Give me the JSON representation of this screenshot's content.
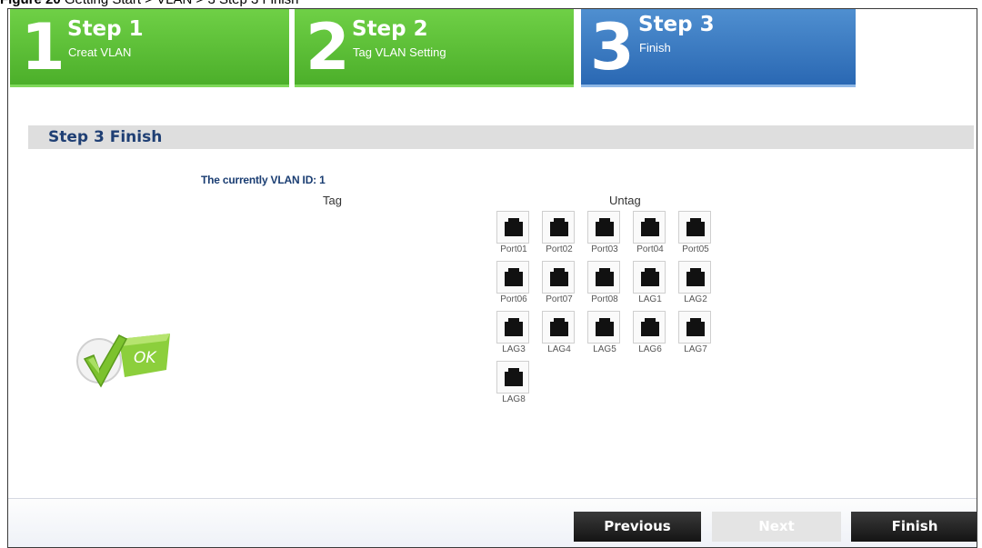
{
  "caption": {
    "prefix": "Figure 20",
    "text": "Getting Start > VLAN > 3 Step 3 Finish"
  },
  "steps": [
    {
      "num": "1",
      "title": "Step 1",
      "subtitle": "Creat VLAN"
    },
    {
      "num": "2",
      "title": "Step 2",
      "subtitle": "Tag VLAN Setting"
    },
    {
      "num": "3",
      "title": "Step 3",
      "subtitle": "Finish"
    }
  ],
  "section_title": "Step 3 Finish",
  "vlan_id_text": "The currently VLAN ID: 1",
  "tag_label": "Tag",
  "untag_label": "Untag",
  "ports": [
    "Port01",
    "Port02",
    "Port03",
    "Port04",
    "Port05",
    "Port06",
    "Port07",
    "Port08",
    "LAG1",
    "LAG2",
    "LAG3",
    "LAG4",
    "LAG5",
    "LAG6",
    "LAG7",
    "LAG8"
  ],
  "ok_badge_text": "OK",
  "buttons": {
    "previous": "Previous",
    "next": "Next",
    "finish": "Finish"
  },
  "colors": {
    "step_active": "#2a68b3",
    "step_done": "#4caf2a",
    "heading": "#1f3f74"
  }
}
